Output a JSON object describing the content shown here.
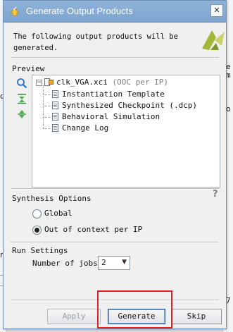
{
  "window": {
    "title": "Generate Output Products",
    "close_glyph": "✕"
  },
  "description": "The following output products will be\ngenerated.",
  "preview": {
    "label": "Preview",
    "root": {
      "name": "clk_VGA.xci",
      "note": "(OOC per IP)"
    },
    "items": [
      "Instantiation Template",
      "Synthesized Checkpoint (.dcp)",
      "Behavioral Simulation",
      "Change Log"
    ],
    "tools": [
      "search-icon",
      "collapse-all-icon",
      "expand-all-icon"
    ]
  },
  "synthesis": {
    "label": "Synthesis Options",
    "help": "?",
    "options": [
      {
        "label": "Global",
        "selected": false
      },
      {
        "label": "Out of context per IP",
        "selected": true
      }
    ]
  },
  "run_settings": {
    "label": "Run Settings",
    "jobs_label": "Number of jobs:",
    "jobs_value": "2"
  },
  "buttons": {
    "apply": "Apply",
    "generate": "Generate",
    "skip": "Skip"
  },
  "background_fragments": [
    "d",
    "e",
    "o",
    "_1",
    "_1",
    "n",
    "m",
    "7"
  ],
  "colors": {
    "titlebar": "#8fb3d9",
    "highlight": "#e0242a",
    "dialog_bg": "#f0f0f0"
  }
}
